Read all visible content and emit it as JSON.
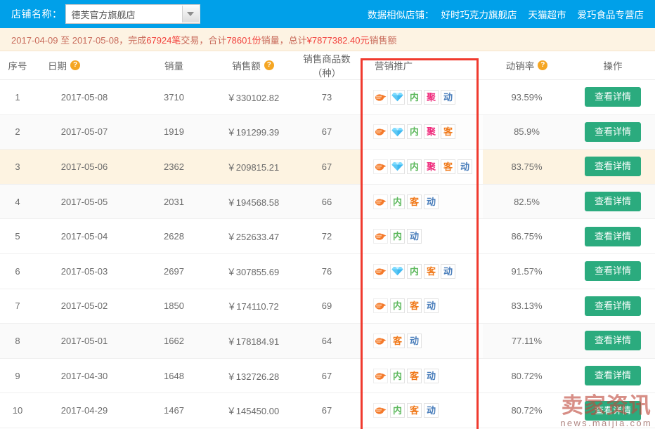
{
  "topbar": {
    "shop_label": "店铺名称：",
    "shop_select_value": "德芙官方旗舰店",
    "dropdown_icon": "chevron-down-icon",
    "similar_label": "数据相似店铺：",
    "similar_shops": [
      "好时巧克力旗舰店",
      "天猫超市",
      "爱巧食品专营店"
    ],
    "bg_color": "#00a0e9"
  },
  "summary": {
    "date_start": "2017-04-09",
    "date_sep": "至",
    "date_end": "2017-05-08",
    "text_parts": [
      {
        "t": "2017-04-09 ",
        "hl": false
      },
      {
        "t": "至",
        "hl": false
      },
      {
        "t": " 2017-05-08，完成",
        "hl": false
      },
      {
        "t": "67924笔",
        "hl": true
      },
      {
        "t": "交易，合计",
        "hl": false
      },
      {
        "t": "78601份",
        "hl": true
      },
      {
        "t": "销量，总计",
        "hl": false
      },
      {
        "t": "¥7877382.40元",
        "hl": true
      },
      {
        "t": "销售额",
        "hl": false
      }
    ],
    "transactions": "67924",
    "sales_volume": "78601",
    "total_amount": "¥7877382.40",
    "bg_color": "#fdf3e3",
    "text_color": "#c86a5a",
    "highlight_color": "#f2413c"
  },
  "table": {
    "columns": [
      {
        "key": "index",
        "label": "序号",
        "help": false
      },
      {
        "key": "date",
        "label": "日期",
        "help": true
      },
      {
        "key": "volume",
        "label": "销量",
        "help": false
      },
      {
        "key": "amount",
        "label": "销售额",
        "help": true
      },
      {
        "key": "skus",
        "label": "销售商品数（种）",
        "help": false
      },
      {
        "key": "promo",
        "label": "营销推广",
        "help": false
      },
      {
        "key": "rate",
        "label": "动销率",
        "help": true
      },
      {
        "key": "action",
        "label": "操作",
        "help": false
      }
    ],
    "help_icon": "question-mark-icon",
    "action_button_label": "查看详情",
    "action_button_color": "#2bab7e",
    "promo_icon_labels": {
      "train": "直通车",
      "diamond": "钻石展位",
      "nei": "内",
      "ju": "聚",
      "ke": "客",
      "dong": "动"
    },
    "rows": [
      {
        "index": "1",
        "date": "2017-05-08",
        "volume": "3710",
        "amount": "￥330102.82",
        "skus": "73",
        "promo": [
          "train",
          "diamond",
          "nei",
          "ju",
          "dong"
        ],
        "rate": "93.59%",
        "style": "row-white"
      },
      {
        "index": "2",
        "date": "2017-05-07",
        "volume": "1919",
        "amount": "￥191299.39",
        "skus": "67",
        "promo": [
          "train",
          "diamond",
          "nei",
          "ju",
          "ke"
        ],
        "rate": "85.9%",
        "style": "row-grey"
      },
      {
        "index": "3",
        "date": "2017-05-06",
        "volume": "2362",
        "amount": "￥209815.21",
        "skus": "67",
        "promo": [
          "train",
          "diamond",
          "nei",
          "ju",
          "ke",
          "dong"
        ],
        "rate": "83.75%",
        "style": "row-cream"
      },
      {
        "index": "4",
        "date": "2017-05-05",
        "volume": "2031",
        "amount": "￥194568.58",
        "skus": "66",
        "promo": [
          "train",
          "nei",
          "ke",
          "dong"
        ],
        "rate": "82.5%",
        "style": "row-grey"
      },
      {
        "index": "5",
        "date": "2017-05-04",
        "volume": "2628",
        "amount": "￥252633.47",
        "skus": "72",
        "promo": [
          "train",
          "nei",
          "dong"
        ],
        "rate": "86.75%",
        "style": "row-white"
      },
      {
        "index": "6",
        "date": "2017-05-03",
        "volume": "2697",
        "amount": "￥307855.69",
        "skus": "76",
        "promo": [
          "train",
          "diamond",
          "nei",
          "ke",
          "dong"
        ],
        "rate": "91.57%",
        "style": "row-white"
      },
      {
        "index": "7",
        "date": "2017-05-02",
        "volume": "1850",
        "amount": "￥174110.72",
        "skus": "69",
        "promo": [
          "train",
          "nei",
          "ke",
          "dong"
        ],
        "rate": "83.13%",
        "style": "row-white"
      },
      {
        "index": "8",
        "date": "2017-05-01",
        "volume": "1662",
        "amount": "￥178184.91",
        "skus": "64",
        "promo": [
          "train",
          "ke",
          "dong"
        ],
        "rate": "77.11%",
        "style": "row-grey"
      },
      {
        "index": "9",
        "date": "2017-04-30",
        "volume": "1648",
        "amount": "￥132726.28",
        "skus": "67",
        "promo": [
          "train",
          "nei",
          "ke",
          "dong"
        ],
        "rate": "80.72%",
        "style": "row-white"
      },
      {
        "index": "10",
        "date": "2017-04-29",
        "volume": "1467",
        "amount": "￥145450.00",
        "skus": "67",
        "promo": [
          "train",
          "nei",
          "ke",
          "dong"
        ],
        "rate": "80.72%",
        "style": "row-white"
      }
    ]
  },
  "highlight_box": {
    "color": "#f03a2e",
    "target_column": "营销推广"
  },
  "watermark": {
    "cn": "卖家资讯",
    "en": "news.maijia.com"
  }
}
